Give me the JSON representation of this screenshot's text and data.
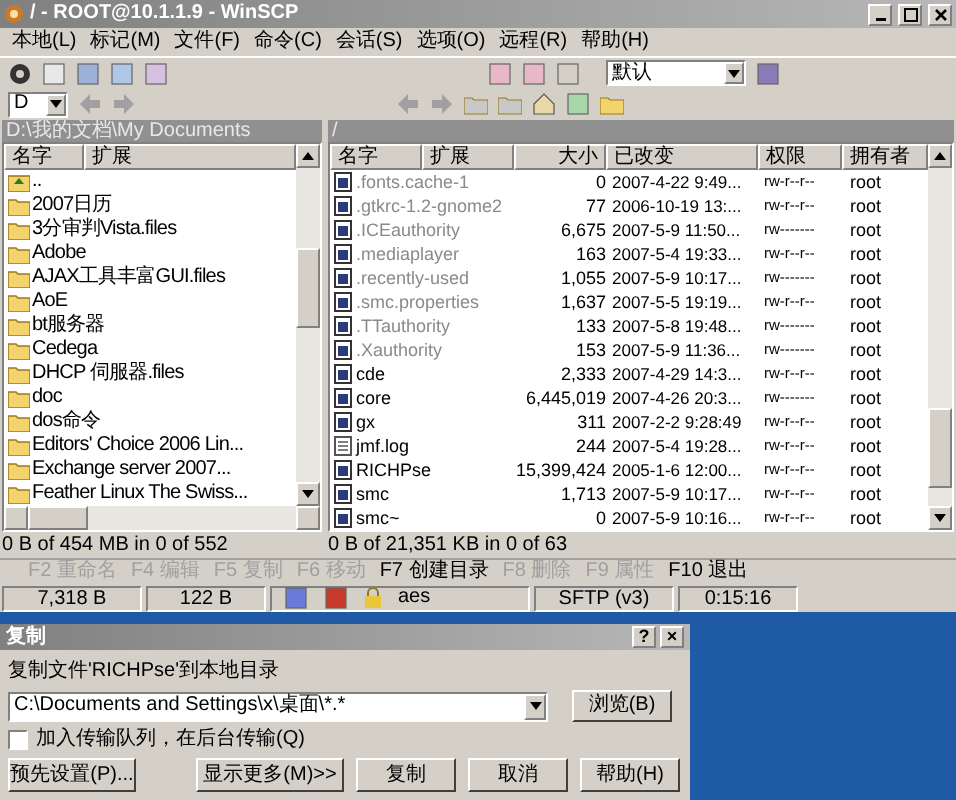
{
  "window": {
    "title": "/ - ROOT@10.1.1.9 - WinSCP"
  },
  "menu": [
    "本地(L)",
    "标记(M)",
    "文件(F)",
    "命令(C)",
    "会话(S)",
    "选项(O)",
    "远程(R)",
    "帮助(H)"
  ],
  "toolbar": {
    "profile": "默认"
  },
  "drive": {
    "value": "D"
  },
  "left_panel": {
    "path": "D:\\我的文档\\My Documents",
    "columns": [
      "名字",
      "扩展"
    ],
    "rows": [
      {
        "name": "..",
        "kind": "parent"
      },
      {
        "name": "2007日历",
        "kind": "folder"
      },
      {
        "name": "3分审判Vista.files",
        "kind": "folder"
      },
      {
        "name": "Adobe",
        "kind": "folder"
      },
      {
        "name": "AJAX工具丰富GUI.files",
        "kind": "folder"
      },
      {
        "name": "AoE",
        "kind": "folder"
      },
      {
        "name": "bt服务器",
        "kind": "folder"
      },
      {
        "name": "Cedega",
        "kind": "folder"
      },
      {
        "name": "DHCP 伺服器.files",
        "kind": "folder"
      },
      {
        "name": "doc",
        "kind": "folder"
      },
      {
        "name": "dos命令",
        "kind": "folder"
      },
      {
        "name": "Editors' Choice 2006  Lin...",
        "kind": "folder"
      },
      {
        "name": "Exchange server 2007...",
        "kind": "folder"
      },
      {
        "name": "Feather Linux The Swiss...",
        "kind": "folder"
      }
    ],
    "status": "0 B of 454 MB in 0 of 552"
  },
  "right_panel": {
    "path": "/",
    "columns": [
      "名字",
      "扩展",
      "大小",
      "已改变",
      "权限",
      "拥有者"
    ],
    "rows": [
      {
        "name": ".fonts.cache-1",
        "size": "0",
        "changed": "2007-4-22 9:49...",
        "rights": "rw-r--r--",
        "owner": "root",
        "hidden": true,
        "kind": "binary"
      },
      {
        "name": ".gtkrc-1.2-gnome2",
        "size": "77",
        "changed": "2006-10-19 13:...",
        "rights": "rw-r--r--",
        "owner": "root",
        "hidden": true,
        "kind": "binary"
      },
      {
        "name": ".ICEauthority",
        "size": "6,675",
        "changed": "2007-5-9 11:50...",
        "rights": "rw-------",
        "owner": "root",
        "hidden": true,
        "kind": "binary"
      },
      {
        "name": ".mediaplayer",
        "size": "163",
        "changed": "2007-5-4 19:33...",
        "rights": "rw-r--r--",
        "owner": "root",
        "hidden": true,
        "kind": "binary"
      },
      {
        "name": ".recently-used",
        "size": "1,055",
        "changed": "2007-5-9 10:17...",
        "rights": "rw-------",
        "owner": "root",
        "hidden": true,
        "kind": "binary"
      },
      {
        "name": ".smc.properties",
        "size": "1,637",
        "changed": "2007-5-5 19:19...",
        "rights": "rw-r--r--",
        "owner": "root",
        "hidden": true,
        "kind": "binary"
      },
      {
        "name": ".TTauthority",
        "size": "133",
        "changed": "2007-5-8 19:48...",
        "rights": "rw-------",
        "owner": "root",
        "hidden": true,
        "kind": "binary"
      },
      {
        "name": ".Xauthority",
        "size": "153",
        "changed": "2007-5-9 11:36...",
        "rights": "rw-------",
        "owner": "root",
        "hidden": true,
        "kind": "binary"
      },
      {
        "name": "cde",
        "size": "2,333",
        "changed": "2007-4-29 14:3...",
        "rights": "rw-r--r--",
        "owner": "root",
        "hidden": false,
        "kind": "binary"
      },
      {
        "name": "core",
        "size": "6,445,019",
        "changed": "2007-4-26 20:3...",
        "rights": "rw-------",
        "owner": "root",
        "hidden": false,
        "kind": "binary"
      },
      {
        "name": "gx",
        "size": "311",
        "changed": "2007-2-2 9:28:49",
        "rights": "rw-r--r--",
        "owner": "root",
        "hidden": false,
        "kind": "binary"
      },
      {
        "name": "jmf.log",
        "size": "244",
        "changed": "2007-5-4 19:28...",
        "rights": "rw-r--r--",
        "owner": "root",
        "hidden": false,
        "kind": "text"
      },
      {
        "name": "RICHPse",
        "size": "15,399,424",
        "changed": "2005-1-6 12:00...",
        "rights": "rw-r--r--",
        "owner": "root",
        "hidden": false,
        "kind": "binary"
      },
      {
        "name": "smc",
        "size": "1,713",
        "changed": "2007-5-9 10:17...",
        "rights": "rw-r--r--",
        "owner": "root",
        "hidden": false,
        "kind": "binary"
      },
      {
        "name": "smc~",
        "size": "0",
        "changed": "2007-5-9 10:16...",
        "rights": "rw-r--r--",
        "owner": "root",
        "hidden": false,
        "kind": "binary"
      }
    ],
    "status": "0 B of 21,351 KB in 0 of 63"
  },
  "function_keys": [
    {
      "label": "F2 重命名",
      "disabled": true
    },
    {
      "label": "F4 编辑",
      "disabled": true
    },
    {
      "label": "F5 复制",
      "disabled": true
    },
    {
      "label": "F6 移动",
      "disabled": true
    },
    {
      "label": "F7 创建目录",
      "disabled": false
    },
    {
      "label": "F8 删除",
      "disabled": true
    },
    {
      "label": "F9 属性",
      "disabled": true
    },
    {
      "label": "F10 退出",
      "disabled": false
    }
  ],
  "status_bar": {
    "uploaded": "7,318 B",
    "downloaded": "122 B",
    "cipher": "aes",
    "protocol": "SFTP (v3)",
    "duration": "0:15:16"
  },
  "dialog": {
    "title": "复制",
    "help_button": "?",
    "close_button": "×",
    "label": "复制文件'RICHPse'到本地目录",
    "target": "C:\\Documents and Settings\\x\\桌面\\*.*",
    "browse": "浏览(B)",
    "queue": {
      "label": "加入传输队列，在后台传输(Q)",
      "checked": false
    },
    "buttons": [
      "预先设置(P)...",
      "显示更多(M)>>",
      "复制",
      "取消",
      "帮助(H)"
    ]
  }
}
